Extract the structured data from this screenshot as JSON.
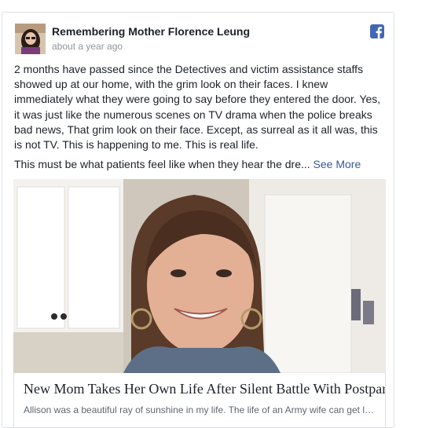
{
  "post": {
    "author": "Remembering Mother Florence Leung",
    "timestamp": "about a year ago",
    "paragraph1": "2 months have passed since the Detectives and victim assistance staffs showed up at our home, with the grim look on their faces. I knew immediately what they were going to say before they entered the door. Yes, it was just like the numerous scenes on TV drama when the police breaks bad news, That grim look on their face. Except, as surreal as it all was, this is not TV. This is happening to me. This is real life.",
    "paragraph2": "This must be what patients feel like when they hear the dre...",
    "see_more": "See More"
  },
  "link_preview": {
    "title": "New Mom Takes Her Own Life After Silent Battle With Postpartum Depression",
    "description": "Allison was a beautiful ray of sunshine in my life. The life of an Army wife can get lonely"
  },
  "colors": {
    "facebook_blue": "#4267b2",
    "link_blue": "#365899",
    "text": "#1d2129",
    "meta_gray": "#90949c"
  },
  "icons": {
    "platform": "facebook-icon",
    "avatar": "avatar-photo"
  }
}
